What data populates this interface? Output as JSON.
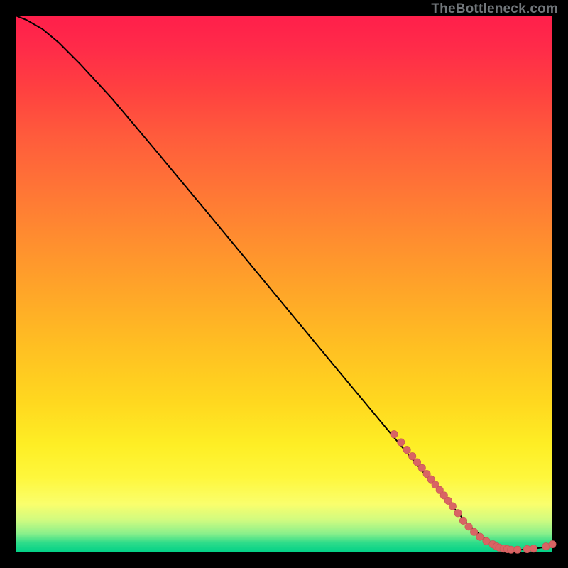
{
  "watermark": "TheBottleneck.com",
  "colors": {
    "background": "#000000",
    "curve_stroke": "#000000",
    "marker_fill": "#d96464",
    "marker_stroke": "#c75454"
  },
  "chart_data": {
    "type": "line",
    "title": "",
    "xlabel": "",
    "ylabel": "",
    "xlim": [
      0,
      100
    ],
    "ylim": [
      0,
      100
    ],
    "series": [
      {
        "name": "curve",
        "x": [
          0,
          2,
          5,
          8,
          12,
          18,
          26,
          36,
          48,
          60,
          70,
          78,
          84,
          88,
          90,
          92,
          94,
          96,
          98,
          100
        ],
        "y": [
          100,
          99.2,
          97.5,
          95.0,
          91.0,
          84.5,
          75.0,
          63.0,
          48.5,
          34.0,
          22.0,
          12.5,
          5.5,
          2.0,
          1.0,
          0.6,
          0.5,
          0.6,
          0.9,
          1.5
        ]
      }
    ],
    "markers": [
      {
        "x": 70.5,
        "y": 22.0
      },
      {
        "x": 71.8,
        "y": 20.5
      },
      {
        "x": 72.9,
        "y": 19.1
      },
      {
        "x": 73.9,
        "y": 17.9
      },
      {
        "x": 74.8,
        "y": 16.8
      },
      {
        "x": 75.7,
        "y": 15.7
      },
      {
        "x": 76.6,
        "y": 14.6
      },
      {
        "x": 77.4,
        "y": 13.6
      },
      {
        "x": 78.2,
        "y": 12.6
      },
      {
        "x": 79.0,
        "y": 11.6
      },
      {
        "x": 79.8,
        "y": 10.6
      },
      {
        "x": 80.6,
        "y": 9.6
      },
      {
        "x": 81.4,
        "y": 8.6
      },
      {
        "x": 82.4,
        "y": 7.3
      },
      {
        "x": 83.4,
        "y": 5.9
      },
      {
        "x": 84.4,
        "y": 4.8
      },
      {
        "x": 85.4,
        "y": 3.8
      },
      {
        "x": 86.5,
        "y": 2.9
      },
      {
        "x": 87.7,
        "y": 2.1
      },
      {
        "x": 88.9,
        "y": 1.5
      },
      {
        "x": 89.6,
        "y": 1.1
      },
      {
        "x": 90.1,
        "y": 0.9
      },
      {
        "x": 90.9,
        "y": 0.7
      },
      {
        "x": 91.6,
        "y": 0.6
      },
      {
        "x": 92.3,
        "y": 0.5
      },
      {
        "x": 93.5,
        "y": 0.5
      },
      {
        "x": 95.3,
        "y": 0.6
      },
      {
        "x": 96.5,
        "y": 0.7
      },
      {
        "x": 98.8,
        "y": 1.1
      },
      {
        "x": 100.0,
        "y": 1.5
      }
    ]
  }
}
